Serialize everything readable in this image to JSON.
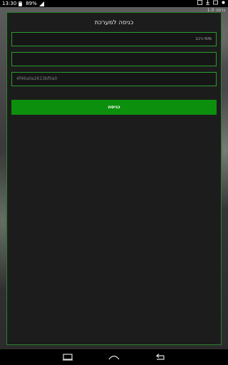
{
  "statusbar": {
    "time": "13:30",
    "battery": "89%"
  },
  "app": {
    "version": "גרסה 1.0"
  },
  "login_panel": {
    "title": "כניסה למערכת",
    "fields": [
      {
        "value": "מיפי-רכב",
        "placeholder": ""
      },
      {
        "value": "",
        "placeholder": ""
      },
      {
        "value": "4f46a0a2613bf0a0",
        "placeholder": ""
      }
    ],
    "submit_label": "כניסה"
  },
  "navbar": {
    "icons": [
      "recent-apps-icon",
      "home-icon",
      "back-icon"
    ]
  },
  "colors": {
    "accent": "#0c8f0c",
    "border": "#2a9a2a"
  }
}
